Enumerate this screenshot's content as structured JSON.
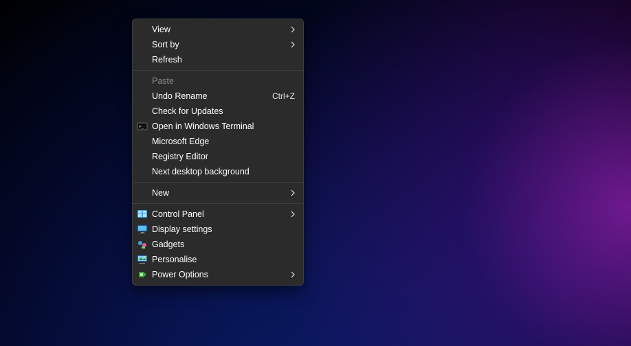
{
  "contextMenu": {
    "sections": [
      [
        {
          "id": "view",
          "label": "View",
          "submenu": true
        },
        {
          "id": "sort-by",
          "label": "Sort by",
          "submenu": true
        },
        {
          "id": "refresh",
          "label": "Refresh"
        }
      ],
      [
        {
          "id": "paste",
          "label": "Paste",
          "disabled": true
        },
        {
          "id": "undo-rename",
          "label": "Undo Rename",
          "shortcut": "Ctrl+Z"
        },
        {
          "id": "check-updates",
          "label": "Check for Updates"
        },
        {
          "id": "open-terminal",
          "label": "Open in Windows Terminal",
          "icon": "terminal-icon"
        },
        {
          "id": "ms-edge",
          "label": "Microsoft Edge"
        },
        {
          "id": "registry-editor",
          "label": "Registry Editor"
        },
        {
          "id": "next-bg",
          "label": "Next desktop background"
        }
      ],
      [
        {
          "id": "new",
          "label": "New",
          "submenu": true
        }
      ],
      [
        {
          "id": "control-panel",
          "label": "Control Panel",
          "icon": "control-panel-icon",
          "submenu": true
        },
        {
          "id": "display-settings",
          "label": "Display settings",
          "icon": "display-icon"
        },
        {
          "id": "gadgets",
          "label": "Gadgets",
          "icon": "gadgets-icon"
        },
        {
          "id": "personalise",
          "label": "Personalise",
          "icon": "personalise-icon"
        },
        {
          "id": "power-options",
          "label": "Power Options",
          "icon": "power-icon",
          "submenu": true
        }
      ]
    ]
  }
}
